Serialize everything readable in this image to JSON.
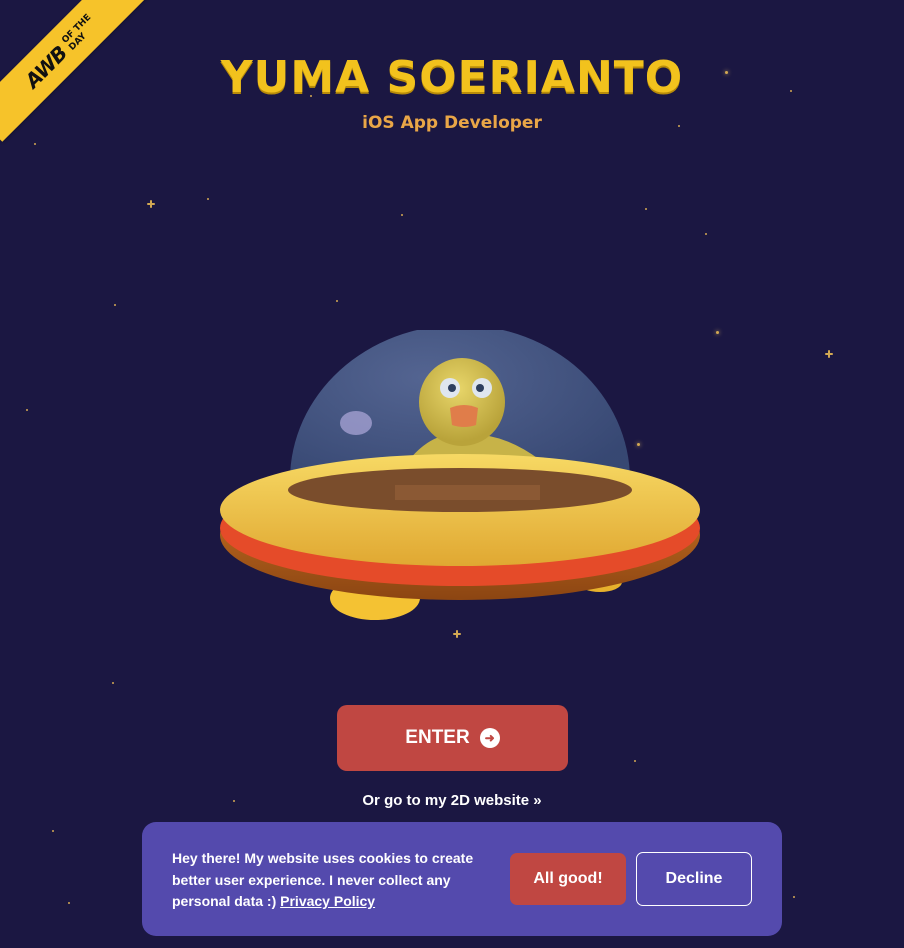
{
  "badge": {
    "logo": "AWB",
    "line1": "OF THE",
    "line2": "DAY",
    "color": "#f6c32a"
  },
  "header": {
    "title": "YUMA SOERIANTO",
    "subtitle": "iOS App Developer"
  },
  "hero": {
    "illustration": "duck-ufo"
  },
  "actions": {
    "enter_label": "ENTER",
    "enter_icon": "arrow-circle-right-icon",
    "alt_link": "Or go to my 2D website »"
  },
  "cookie": {
    "message": "Hey there! My website uses cookies to create better user experience. I never collect any personal data :)",
    "policy_link": "Privacy Policy",
    "accept_label": "All good!",
    "decline_label": "Decline"
  },
  "colors": {
    "background": "#1b1742",
    "title": "#f2c21d",
    "subtitle": "#e9a647",
    "accent_red": "#c04742",
    "banner": "#544aad"
  }
}
